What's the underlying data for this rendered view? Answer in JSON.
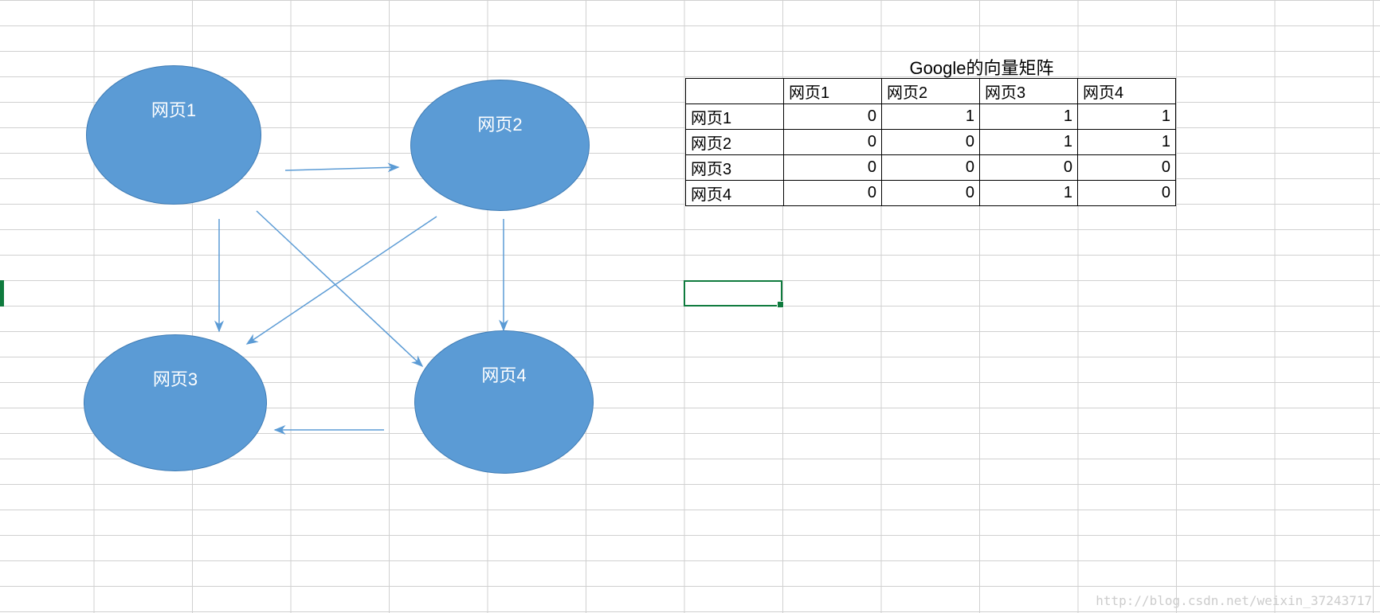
{
  "diagram": {
    "nodes": {
      "n1": "网页1",
      "n2": "网页2",
      "n3": "网页3",
      "n4": "网页4"
    },
    "edges_description": "网页1→网页2, 网页1→网页3, 网页1→网页4, 网页2→网页3, 网页2→网页4, 网页4→网页3"
  },
  "matrix_title": "Google的向量矩阵",
  "matrix": {
    "col_headers": [
      "网页1",
      "网页2",
      "网页3",
      "网页4"
    ],
    "row_headers": [
      "网页1",
      "网页2",
      "网页3",
      "网页4"
    ],
    "cells": {
      "r0c0": "0",
      "r0c1": "1",
      "r0c2": "1",
      "r0c3": "1",
      "r1c0": "0",
      "r1c1": "0",
      "r1c2": "1",
      "r1c3": "1",
      "r2c0": "0",
      "r2c1": "0",
      "r2c2": "0",
      "r2c3": "0",
      "r3c0": "0",
      "r3c1": "0",
      "r3c2": "1",
      "r3c3": "0"
    }
  },
  "chart_data": {
    "type": "table",
    "title": "Google的向量矩阵",
    "columns": [
      "",
      "网页1",
      "网页2",
      "网页3",
      "网页4"
    ],
    "rows": [
      [
        "网页1",
        0,
        1,
        1,
        1
      ],
      [
        "网页2",
        0,
        0,
        1,
        1
      ],
      [
        "网页3",
        0,
        0,
        0,
        0
      ],
      [
        "网页4",
        0,
        0,
        1,
        0
      ]
    ]
  },
  "watermark": "http://blog.csdn.net/weixin_37243717"
}
